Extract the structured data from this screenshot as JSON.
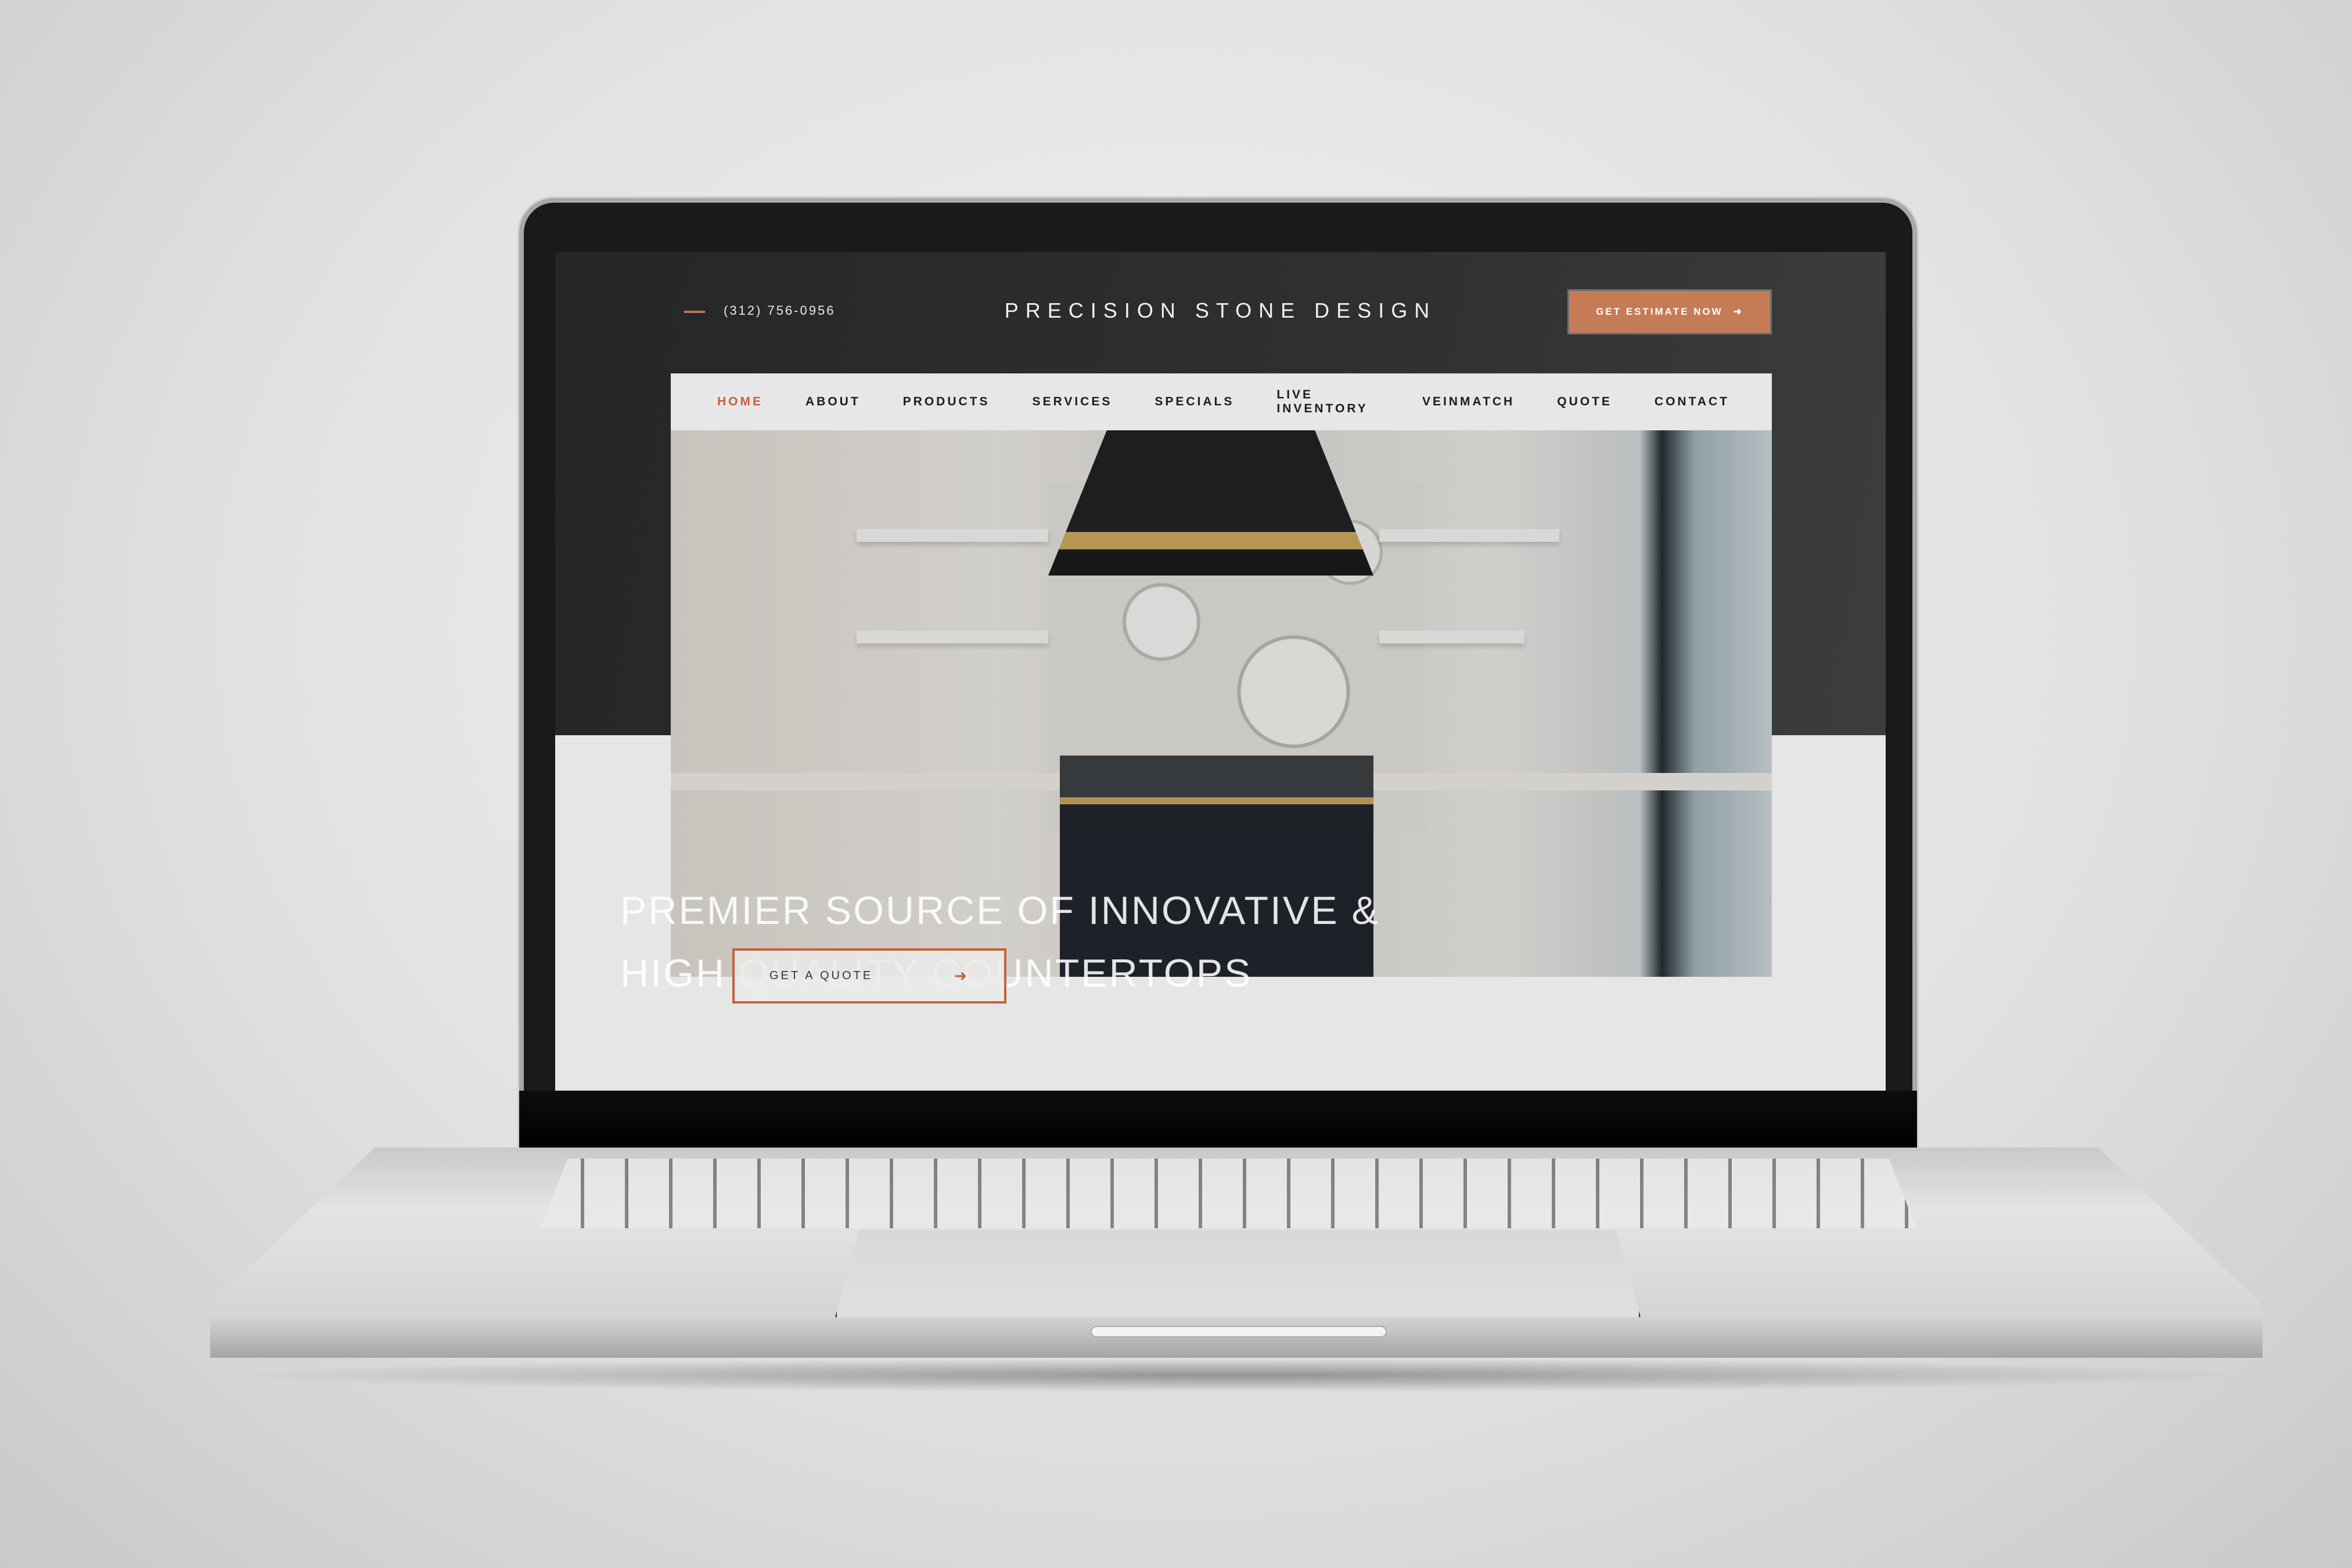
{
  "header": {
    "phone": "(312) 756-0956",
    "logo": "PRECISION STONE DESIGN",
    "cta_label": "GET ESTIMATE NOW",
    "cta_icon": "arrow-right-icon"
  },
  "nav": {
    "items": [
      {
        "label": "HOME",
        "active": true
      },
      {
        "label": "ABOUT"
      },
      {
        "label": "PRODUCTS"
      },
      {
        "label": "SERVICES"
      },
      {
        "label": "SPECIALS"
      },
      {
        "label": "LIVE INVENTORY"
      },
      {
        "label": "VEINMATCH"
      },
      {
        "label": "QUOTE"
      },
      {
        "label": "CONTACT"
      }
    ]
  },
  "hero": {
    "line1": "PREMIER SOURCE OF INNOVATIVE &",
    "line2": "HIGH QUALITY COUNTERTOPS",
    "button_label": "GET A QUOTE",
    "button_icon": "arrow-right-icon"
  },
  "colors": {
    "accent": "#c4613b",
    "cta_bg": "#c67b57",
    "header_bg": "#2a2c2d",
    "nav_bg": "#e7e7e7"
  }
}
